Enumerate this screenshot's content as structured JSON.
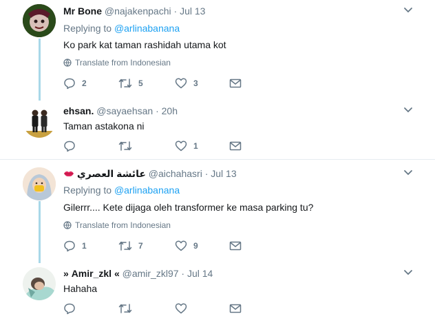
{
  "tweets": [
    {
      "name": "Mr Bone",
      "handle": "@najakenpachi",
      "dot": "·",
      "time": "Jul 13",
      "replying_prefix": "Replying to",
      "replying_to": "@arlinabanana",
      "text": "Ko park kat taman rashidah utama kot",
      "translate": "Translate from Indonesian",
      "replies": "2",
      "retweets": "5",
      "likes": "3"
    },
    {
      "name": "ehsan.",
      "handle": "@sayaehsan",
      "dot": "·",
      "time": "20h",
      "text": "Taman astakona ni",
      "replies": "",
      "retweets": "",
      "likes": "1"
    },
    {
      "name": "عائشة العصري",
      "handle": "@aichahasri",
      "dot": "·",
      "time": "Jul 13",
      "replying_prefix": "Replying to",
      "replying_to": "@arlinabanana",
      "text": "Gilerrr.... Kete dijaga oleh transformer ke masa parking tu?",
      "translate": "Translate from Indonesian",
      "replies": "1",
      "retweets": "7",
      "likes": "9"
    },
    {
      "name": "Amir_zkl",
      "handle": "@amir_zkl97",
      "dot": "·",
      "time": "Jul 14",
      "text": "Hahaha",
      "replies": "",
      "retweets": "",
      "likes": ""
    }
  ],
  "colors": {
    "accent": "#1da1f2",
    "muted": "#657786",
    "thread_line": "#a8d8e8",
    "divider": "#e6ecf0"
  }
}
